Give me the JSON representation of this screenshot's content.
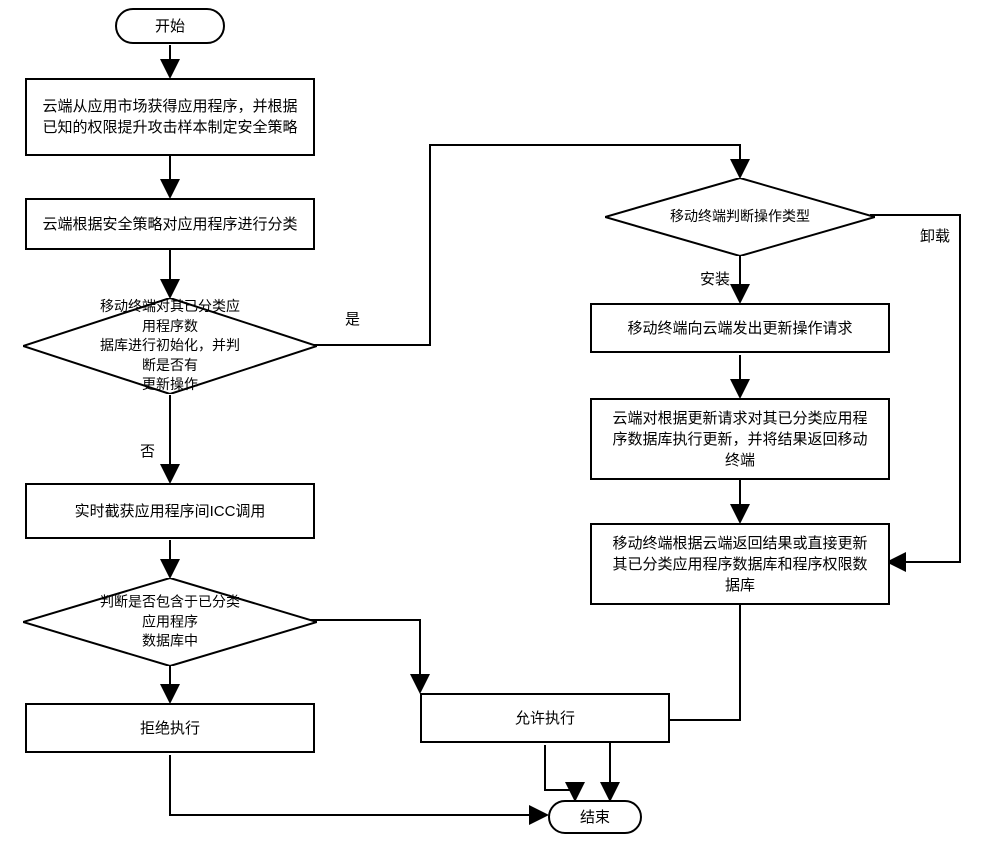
{
  "chart_data": {
    "type": "flowchart",
    "nodes": [
      {
        "id": "start",
        "shape": "terminator",
        "text": "开始"
      },
      {
        "id": "p1",
        "shape": "process",
        "text": "云端从应用市场获得应用程序，并根据已知的权限提升攻击样本制定安全策略"
      },
      {
        "id": "p2",
        "shape": "process",
        "text": "云端根据安全策略对应用程序进行分类"
      },
      {
        "id": "d1",
        "shape": "decision",
        "text": "移动终端对其已分类应用程序数据库进行初始化，并判断是否有更新操作"
      },
      {
        "id": "p3",
        "shape": "process",
        "text": "实时截获应用程序间ICC调用"
      },
      {
        "id": "d2",
        "shape": "decision",
        "text": "判断是否包含于已分类应用程序数据库中"
      },
      {
        "id": "p4",
        "shape": "process",
        "text": "拒绝执行"
      },
      {
        "id": "d3",
        "shape": "decision",
        "text": "移动终端判断操作类型"
      },
      {
        "id": "p5",
        "shape": "process",
        "text": "移动终端向云端发出更新操作请求"
      },
      {
        "id": "p6",
        "shape": "process",
        "text": "云端对根据更新请求对其已分类应用程序数据库执行更新，并将结果返回移动终端"
      },
      {
        "id": "p7",
        "shape": "process",
        "text": "移动终端根据云端返回结果或直接更新其已分类应用程序数据库和程序权限数据库"
      },
      {
        "id": "p8",
        "shape": "process",
        "text": "允许执行"
      },
      {
        "id": "end",
        "shape": "terminator",
        "text": "结束"
      }
    ],
    "edges": [
      {
        "from": "start",
        "to": "p1"
      },
      {
        "from": "p1",
        "to": "p2"
      },
      {
        "from": "p2",
        "to": "d1"
      },
      {
        "from": "d1",
        "to": "p3",
        "label": "否"
      },
      {
        "from": "d1",
        "to": "d3",
        "label": "是"
      },
      {
        "from": "p3",
        "to": "d2"
      },
      {
        "from": "d2",
        "to": "p4"
      },
      {
        "from": "d2",
        "to": "p8"
      },
      {
        "from": "p4",
        "to": "end"
      },
      {
        "from": "p8",
        "to": "end"
      },
      {
        "from": "d3",
        "to": "p5",
        "label": "安装"
      },
      {
        "from": "d3",
        "to": "p7",
        "label": "卸载"
      },
      {
        "from": "p5",
        "to": "p6"
      },
      {
        "from": "p6",
        "to": "p7"
      },
      {
        "from": "p7",
        "to": "end"
      }
    ]
  },
  "nodes": {
    "start": "开始",
    "p1": "云端从应用市场获得应用程序，并根据\n已知的权限提升攻击样本制定安全策略",
    "p2": "云端根据安全策略对应用程序进行分类",
    "d1": "移动终端对其已分类应用程序数\n据库进行初始化，并判断是否有\n更新操作",
    "p3": "实时截获应用程序间ICC调用",
    "d2": "判断是否包含于已分类应用程序\n数据库中",
    "p4": "拒绝执行",
    "d3": "移动终端判断操作类型",
    "p5": "移动终端向云端发出更新操作请求",
    "p6": "云端对根据更新请求对其已分类应用程\n序数据库执行更新，并将结果返回移动\n终端",
    "p7": "移动终端根据云端返回结果或直接更新\n其已分类应用程序数据库和程序权限数\n据库",
    "p8": "允许执行",
    "end": "结束"
  },
  "labels": {
    "yes": "是",
    "no": "否",
    "install": "安装",
    "uninstall": "卸载"
  }
}
